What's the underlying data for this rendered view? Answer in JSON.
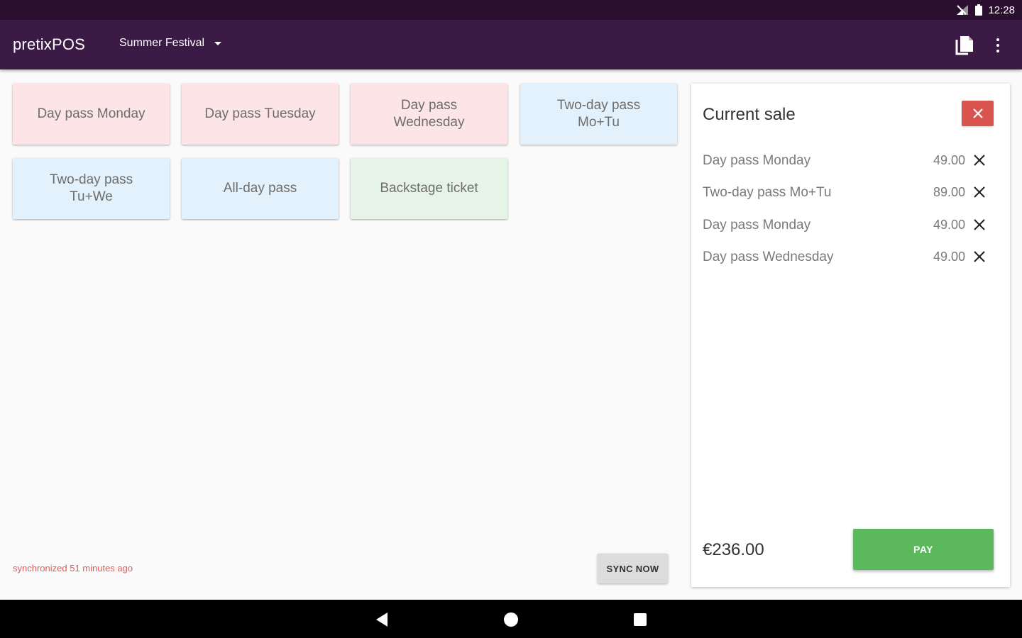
{
  "status_bar": {
    "time": "12:28",
    "icons": [
      "signal-icon",
      "battery-icon"
    ]
  },
  "app_bar": {
    "title": "pretixPOS",
    "event_selector": "Summer Festival",
    "actions": [
      "document-icon",
      "more-vert-icon"
    ]
  },
  "products": [
    {
      "label": "Day pass Monday",
      "color": "#fde4e6"
    },
    {
      "label": "Day pass Tuesday",
      "color": "#fde4e6"
    },
    {
      "label": "Day pass Wednesday",
      "color": "#fde4e6"
    },
    {
      "label": "Two-day pass Mo+Tu",
      "color": "#e3f1fc"
    },
    {
      "label": "Two-day pass Tu+We",
      "color": "#e3f1fc"
    },
    {
      "label": "All-day pass",
      "color": "#e3f1fc"
    },
    {
      "label": "Backstage ticket",
      "color": "#e6f4e8"
    }
  ],
  "sync": {
    "status": "synchronized 51 minutes ago",
    "button": "SYNC NOW"
  },
  "sale": {
    "title": "Current sale",
    "items": [
      {
        "name": "Day pass Monday",
        "price": "49.00"
      },
      {
        "name": "Two-day pass Mo+Tu",
        "price": "89.00"
      },
      {
        "name": "Day pass Monday",
        "price": "49.00"
      },
      {
        "name": "Day pass Wednesday",
        "price": "49.00"
      }
    ],
    "total": "€236.00",
    "pay_button": "PAY"
  },
  "colors": {
    "status_bar": "#2a0f2f",
    "app_bar": "#3c1a46",
    "clear_button": "#d9534f",
    "pay_button": "#5cb85c",
    "sync_status_text": "#e05b5b"
  },
  "nav_bar": {
    "icons": [
      "back-icon",
      "home-icon",
      "recent-apps-icon"
    ]
  }
}
